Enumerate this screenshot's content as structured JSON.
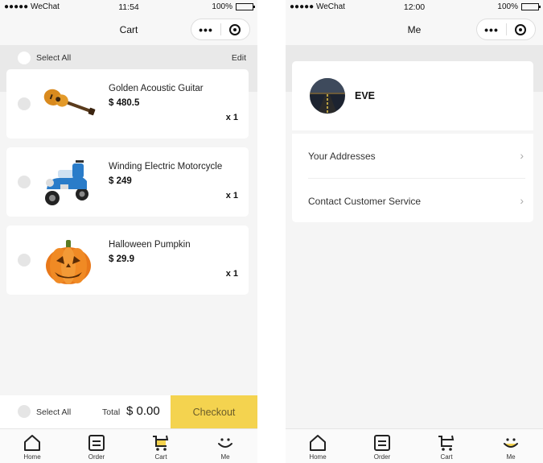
{
  "cart_screen": {
    "status": {
      "carrier": "●●●●● WeChat",
      "time": "11:54",
      "battery": "100%"
    },
    "title": "Cart",
    "select_all_label": "Select All",
    "edit_label": "Edit",
    "items": [
      {
        "name": "Golden Acoustic Guitar",
        "price": "$ 480.5",
        "qty": "x 1",
        "icon": "guitar-image"
      },
      {
        "name": "Winding Electric Motorcycle",
        "price": "$ 249",
        "qty": "x 1",
        "icon": "scooter-image"
      },
      {
        "name": "Halloween Pumpkin",
        "price": "$ 29.9",
        "qty": "x 1",
        "icon": "pumpkin-image"
      }
    ],
    "footer": {
      "select_all_label": "Select All",
      "total_label": "Total",
      "total_value": "$ 0.00",
      "checkout_label": "Checkout"
    }
  },
  "me_screen": {
    "status": {
      "carrier": "●●●●● WeChat",
      "time": "12:00",
      "battery": "100%"
    },
    "title": "Me",
    "username": "EVE",
    "menu": [
      {
        "label": "Your Addresses"
      },
      {
        "label": "Contact Customer Service"
      }
    ]
  },
  "tabbar": {
    "tabs": [
      {
        "label": "Home",
        "icon": "home-icon"
      },
      {
        "label": "Order",
        "icon": "order-icon"
      },
      {
        "label": "Cart",
        "icon": "cart-icon"
      },
      {
        "label": "Me",
        "icon": "smiley-icon"
      }
    ]
  },
  "colors": {
    "accent": "#f4d34f",
    "background": "#f5f5f5",
    "band": "#e9e9e9"
  }
}
